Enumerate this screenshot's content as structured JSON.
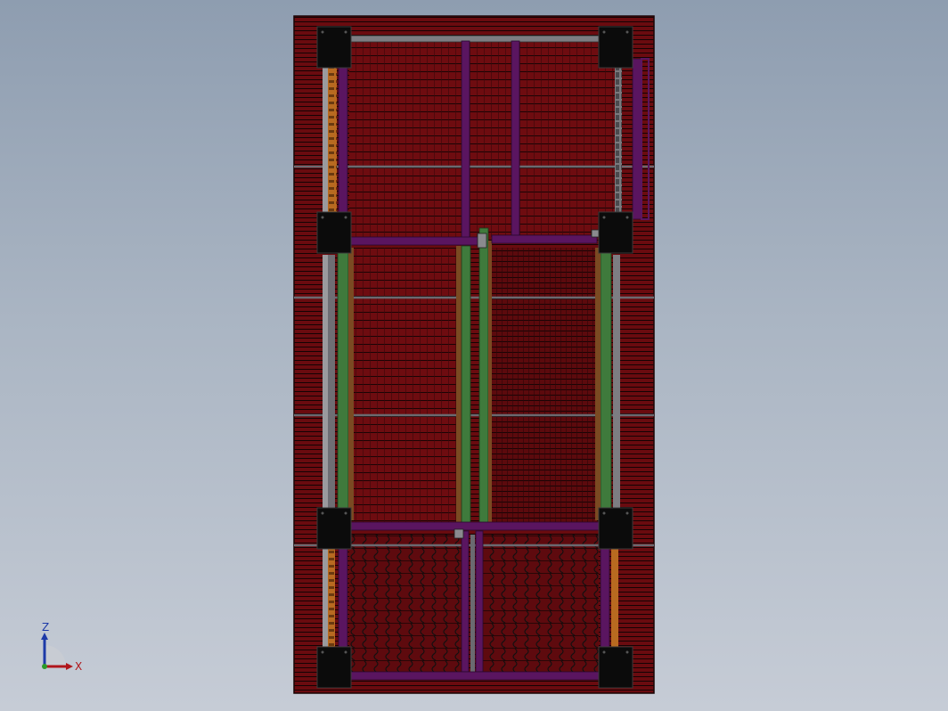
{
  "viewport": {
    "background_top": "#8e9db0",
    "background_bottom": "#c6ccd6"
  },
  "colors": {
    "panel": "#6e0c10",
    "panel_line": "#1a0405",
    "purple": "#5a1560",
    "green": "#3f7a3c",
    "brown": "#7a4a22",
    "orange": "#b86a20",
    "steel": "#7d7d82",
    "bracket": "#0b0b0b"
  },
  "triad": {
    "z_label": "Z",
    "x_label": "X",
    "z_color": "#1d3aa8",
    "x_color": "#b0161b",
    "y_color": "#2a9a2a"
  }
}
